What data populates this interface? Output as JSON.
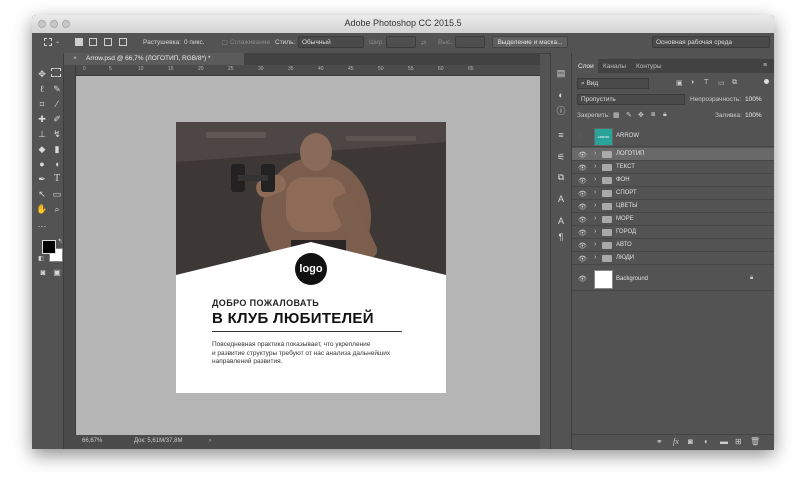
{
  "window": {
    "title": "Adobe Photoshop CC 2015.5"
  },
  "options": {
    "feather_label": "Растушевка:",
    "feather_value": "0 пикс.",
    "antialias_label": "Сглаживание",
    "style_label": "Стиль:",
    "style_value": "Обычный",
    "width_label": "Шир.:",
    "height_label": "Выс.:",
    "mask_button": "Выделение и маска...",
    "workspace_value": "Основная рабочая среда"
  },
  "document": {
    "tab_label": "Arrow.psd @ 66,7% (ЛОГОТИП, RGB/8*) *",
    "zoom": "66,67%",
    "doc_size": "Док: 5,61M/37,8M",
    "logo_text": "logo",
    "heading_small": "ДОБРО ПОЖАЛОВАТЬ",
    "heading_large": "В КЛУБ ЛЮБИТЕЛЕЙ",
    "paragraph": [
      "Повседневная практика показывает, что укрепление",
      "и развитие структуры требуют от нас анализа дальнейших",
      "направлений развития."
    ]
  },
  "ruler": {
    "ticks": [
      "0",
      "5",
      "10",
      "15",
      "20",
      "25",
      "30",
      "35",
      "40",
      "45",
      "50",
      "55",
      "60",
      "65"
    ]
  },
  "layers_panel": {
    "tabs": [
      "Слои",
      "Каналы",
      "Контуры"
    ],
    "filter_value": "Вид",
    "blend_mode": "Пропустить",
    "opacity_label": "Непрозрачность:",
    "opacity_value": "100%",
    "lock_label": "Закрепить:",
    "fill_label": "Заливка:",
    "fill_value": "100%",
    "layers": [
      {
        "name": "ARROW",
        "type": "smart",
        "thumb_text": "ARROW"
      },
      {
        "name": "ЛОГОТИП",
        "type": "group",
        "selected": true
      },
      {
        "name": "ТЕКСТ",
        "type": "group"
      },
      {
        "name": "ФОН",
        "type": "group"
      },
      {
        "name": "СПОРТ",
        "type": "group"
      },
      {
        "name": "ЦВЕТЫ",
        "type": "group"
      },
      {
        "name": "МОРЕ",
        "type": "group"
      },
      {
        "name": "ГОРОД",
        "type": "group"
      },
      {
        "name": "АВТО",
        "type": "group"
      },
      {
        "name": "ЛЮДИ",
        "type": "group"
      },
      {
        "name": "Background",
        "type": "background"
      }
    ]
  },
  "colors": {
    "accent_teal": "#2aa39a",
    "panel_bg": "#535353",
    "canvas_bg": "#b5b5b5"
  }
}
